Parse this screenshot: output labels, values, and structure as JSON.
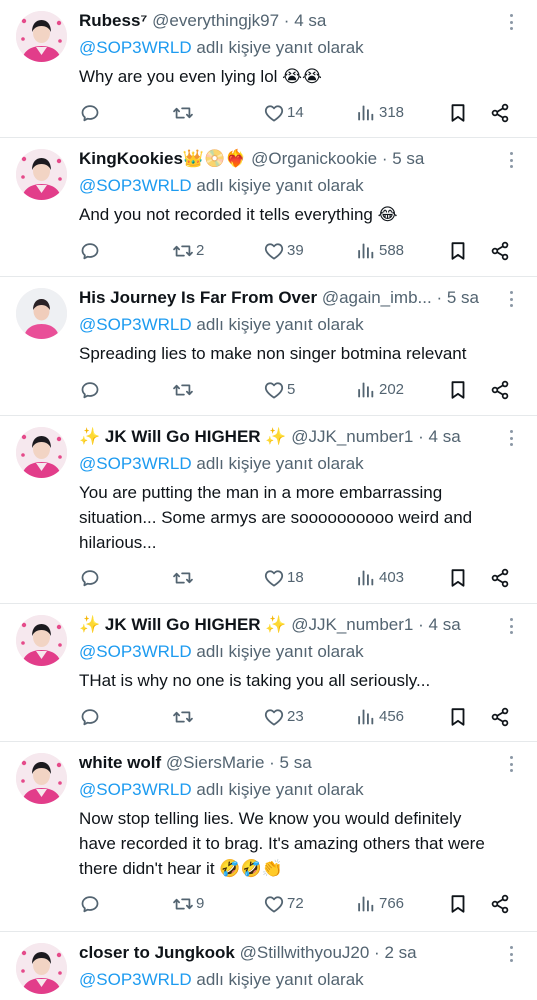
{
  "reply_suffix": "adlı kişiye yanıt olarak",
  "tweets": [
    {
      "name": "Rubess⁷",
      "handle": "@everythingjk97",
      "dot": "·",
      "time": "4 sa",
      "reply_to": "@SOP3WRLD",
      "text": "Why are you even lying lol 😭😭",
      "replies": "",
      "retweets": "",
      "likes": "14",
      "views": "318"
    },
    {
      "name": "KingKookies👑📀❤️‍🔥",
      "handle": "@Organickookie",
      "dot": "·",
      "time": "5 sa",
      "reply_to": "@SOP3WRLD",
      "text": "And you not recorded it tells everything 😂",
      "replies": "",
      "retweets": "2",
      "likes": "39",
      "views": "588"
    },
    {
      "name": "His Journey Is Far From Over",
      "handle": "@again_imb...",
      "dot": "·",
      "time": "5 sa",
      "reply_to": "@SOP3WRLD",
      "text": "Spreading lies to make non singer botmina relevant",
      "replies": "",
      "retweets": "",
      "likes": "5",
      "views": "202"
    },
    {
      "name": "✨ JK Will Go HIGHER ✨",
      "handle": "@JJK_number1",
      "dot": "·",
      "time": "4 sa",
      "reply_to": "@SOP3WRLD",
      "text_lines": [
        "You are putting the man in a more embarrassing",
        "situation... Some armys are soooooooooo weird and",
        "hilarious..."
      ],
      "replies": "",
      "retweets": "",
      "likes": "18",
      "views": "403"
    },
    {
      "name": "✨ JK Will Go HIGHER ✨",
      "handle": "@JJK_number1",
      "dot": "·",
      "time": "4 sa",
      "reply_to": "@SOP3WRLD",
      "text": "THat is why no one is taking you all seriously...",
      "replies": "",
      "retweets": "",
      "likes": "23",
      "views": "456"
    },
    {
      "name": "white wolf",
      "handle": "@SiersMarie",
      "dot": "·",
      "time": "5 sa",
      "reply_to": "@SOP3WRLD",
      "text_lines": [
        "Now stop telling lies. We know you would definitely",
        "have recorded it to brag. It's amazing others that were",
        "there didn't hear it 🤣🤣👏"
      ],
      "replies": "",
      "retweets": "9",
      "likes": "72",
      "views": "766"
    },
    {
      "name": "closer to Jungkook",
      "handle": "@StillwithyouJ20",
      "dot": "·",
      "time": "2 sa",
      "reply_to": "@SOP3WRLD"
    }
  ],
  "icons": {
    "reply": "reply-bubble-icon",
    "retweet": "retweet-arrows-icon",
    "like": "heart-icon",
    "views": "views-bar-chart-icon",
    "bookmark": "bookmark-icon",
    "share": "share-nodes-icon",
    "more": "more-dots-icon"
  },
  "colors": {
    "mention": "#1d9bf0",
    "secondary_text": "#536471",
    "divider": "#e6e9eb"
  }
}
